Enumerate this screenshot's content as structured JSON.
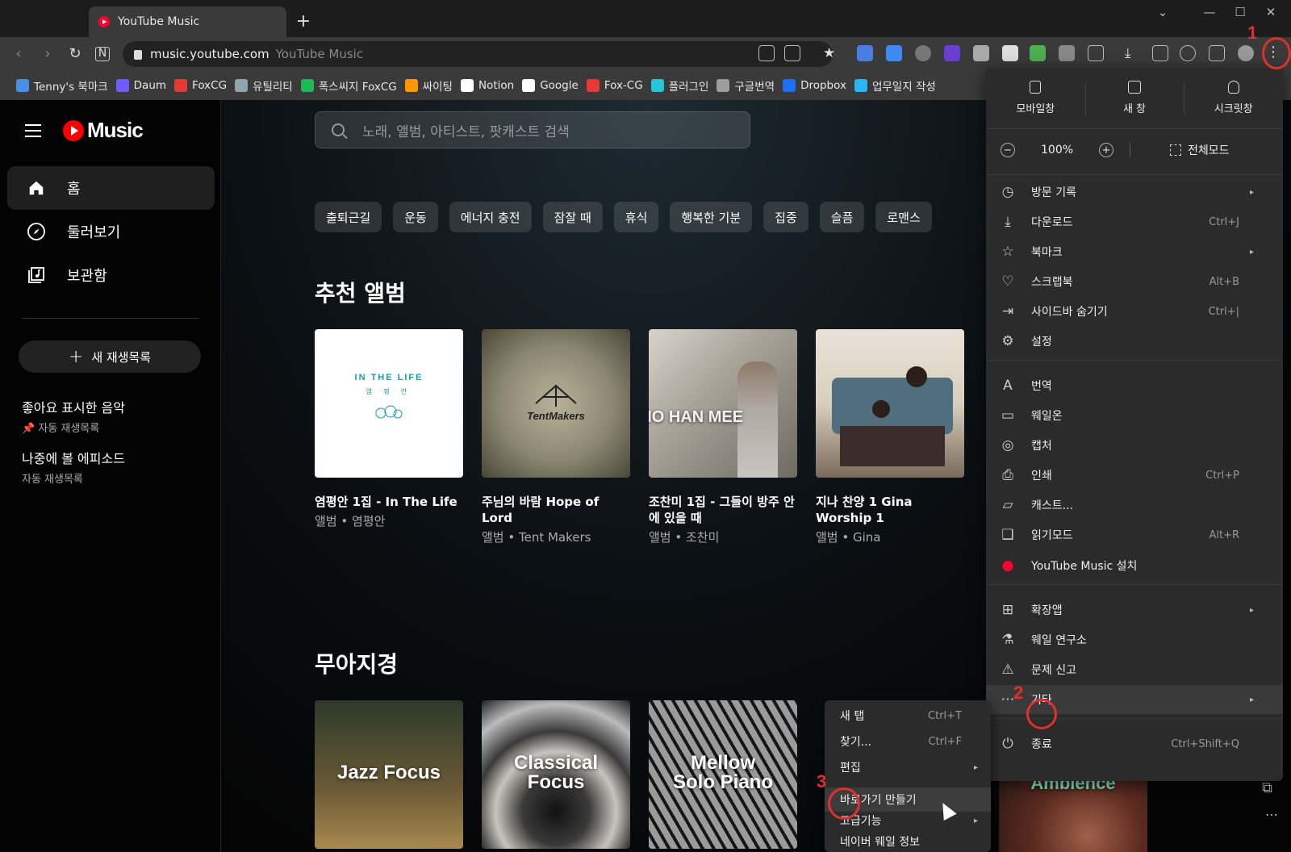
{
  "browser": {
    "tab_title": "YouTube Music",
    "new_tab_symbol": "+",
    "url_host": "music.youtube.com",
    "url_title": "YouTube Music",
    "bookmarks": [
      {
        "label": "Tenny's 북마크",
        "color": "#4a90e2"
      },
      {
        "label": "Daum",
        "color": "#6f5cff"
      },
      {
        "label": "FoxCG",
        "color": "#e53935"
      },
      {
        "label": "유틸리티",
        "color": "#90a4ae"
      },
      {
        "label": "폭스씨지 FoxCG",
        "color": "#1db954"
      },
      {
        "label": "싸이팅",
        "color": "#ff9800"
      },
      {
        "label": "Notion",
        "color": "#ffffff"
      },
      {
        "label": "Google",
        "color": "#ffffff"
      },
      {
        "label": "Fox-CG",
        "color": "#e53935"
      },
      {
        "label": "플러그인",
        "color": "#26c6da"
      },
      {
        "label": "구글번역",
        "color": "#9e9e9e"
      },
      {
        "label": "Dropbox",
        "color": "#1e6ff1"
      },
      {
        "label": "업무일지 작성",
        "color": "#29b6f6"
      }
    ]
  },
  "sidebar": {
    "logo_text": "Music",
    "nav": [
      {
        "label": "홈",
        "icon": "home-icon"
      },
      {
        "label": "둘러보기",
        "icon": "compass-icon"
      },
      {
        "label": "보관함",
        "icon": "library-icon"
      }
    ],
    "new_playlist_label": "새 재생목록",
    "playlists": [
      {
        "title": "좋아요 표시한 음악",
        "subtitle": "자동 재생목록",
        "pinned": true
      },
      {
        "title": "나중에 볼 에피소드",
        "subtitle": "자동 재생목록",
        "pinned": false
      }
    ]
  },
  "main": {
    "search_placeholder": "노래, 앨범, 아티스트, 팟캐스트 검색",
    "chips": [
      "출퇴근길",
      "운동",
      "에너지 충전",
      "잠잘 때",
      "휴식",
      "행복한 기분",
      "집중",
      "슬픔",
      "로맨스"
    ],
    "section1_title": "추천 앨범",
    "albums": [
      {
        "title": "염평안 1집 - In The Life",
        "subtitle": "앨범 • 염평안",
        "art_text": "IN THE LIFE",
        "art_sub": "염 평 안"
      },
      {
        "title": "주님의 바람 Hope of Lord",
        "subtitle": "앨범 • Tent Makers",
        "art_text": "TentMakers"
      },
      {
        "title": "조찬미 1집 - 그들이 방주 안에 있을 때",
        "subtitle": "앨범 • 조찬미",
        "art_text": "CHO HAN MEE"
      },
      {
        "title": "지나 찬양 1 Gina Worship 1",
        "subtitle": "앨범 • Gina"
      }
    ],
    "section2_title": "무아지경",
    "mixes": [
      {
        "art_text": "Jazz Focus"
      },
      {
        "art_text": "Classical Focus"
      },
      {
        "art_text": "Mellow Solo Piano"
      },
      {
        "art_text": "Ambience"
      }
    ]
  },
  "whale_menu": {
    "top": [
      "모바일창",
      "새 창",
      "시크릿창"
    ],
    "zoom_value": "100%",
    "zoom_minus": "−",
    "zoom_plus": "+",
    "fullscreen_label": "전체모드",
    "items": [
      {
        "label": "방문 기록",
        "shortcut": "",
        "submenu": true,
        "icon": "clock-icon"
      },
      {
        "label": "다운로드",
        "shortcut": "Ctrl+J",
        "submenu": false,
        "icon": "download-icon"
      },
      {
        "label": "북마크",
        "shortcut": "",
        "submenu": true,
        "icon": "star-icon"
      },
      {
        "label": "스크랩북",
        "shortcut": "Alt+B",
        "submenu": false,
        "icon": "scrapbook-icon"
      },
      {
        "label": "사이드바 숨기기",
        "shortcut": "Ctrl+|",
        "submenu": false,
        "icon": "sidebar-icon"
      },
      {
        "label": "설정",
        "shortcut": "",
        "submenu": false,
        "icon": "gear-icon"
      },
      {
        "label": "번역",
        "shortcut": "",
        "submenu": false,
        "icon": "translate-icon"
      },
      {
        "label": "웨일온",
        "shortcut": "",
        "submenu": false,
        "icon": "whale-on-icon"
      },
      {
        "label": "캡처",
        "shortcut": "",
        "submenu": false,
        "icon": "capture-icon"
      },
      {
        "label": "인쇄",
        "shortcut": "Ctrl+P",
        "submenu": false,
        "icon": "printer-icon"
      },
      {
        "label": "캐스트...",
        "shortcut": "",
        "submenu": false,
        "icon": "cast-icon"
      },
      {
        "label": "읽기모드",
        "shortcut": "Alt+R",
        "submenu": false,
        "icon": "book-icon"
      },
      {
        "label": "YouTube Music 설치",
        "shortcut": "",
        "submenu": false,
        "icon": "youtube-music-icon"
      },
      {
        "label": "확장앱",
        "shortcut": "",
        "submenu": true,
        "icon": "extensions-icon"
      },
      {
        "label": "웨일 연구소",
        "shortcut": "",
        "submenu": false,
        "icon": "flask-icon"
      },
      {
        "label": "문제 신고",
        "shortcut": "",
        "submenu": false,
        "icon": "report-icon"
      },
      {
        "label": "기타",
        "shortcut": "",
        "submenu": true,
        "icon": "more-icon"
      },
      {
        "label": "종료",
        "shortcut": "Ctrl+Shift+Q",
        "submenu": false,
        "icon": "power-icon"
      }
    ]
  },
  "submenu": {
    "items": [
      {
        "label": "새 탭",
        "shortcut": "Ctrl+T",
        "submenu": false
      },
      {
        "label": "찾기...",
        "shortcut": "Ctrl+F",
        "submenu": false
      },
      {
        "label": "편집",
        "shortcut": "",
        "submenu": true
      },
      {
        "label": "바로가기 만들기",
        "shortcut": "",
        "submenu": false
      },
      {
        "label": "고급기능",
        "shortcut": "",
        "submenu": true
      },
      {
        "label": "네이버 웨일 정보",
        "shortcut": "",
        "submenu": false
      }
    ]
  },
  "annotations": {
    "step1": "1",
    "step2": "2",
    "step3": "3",
    "color": "#e0302c"
  }
}
